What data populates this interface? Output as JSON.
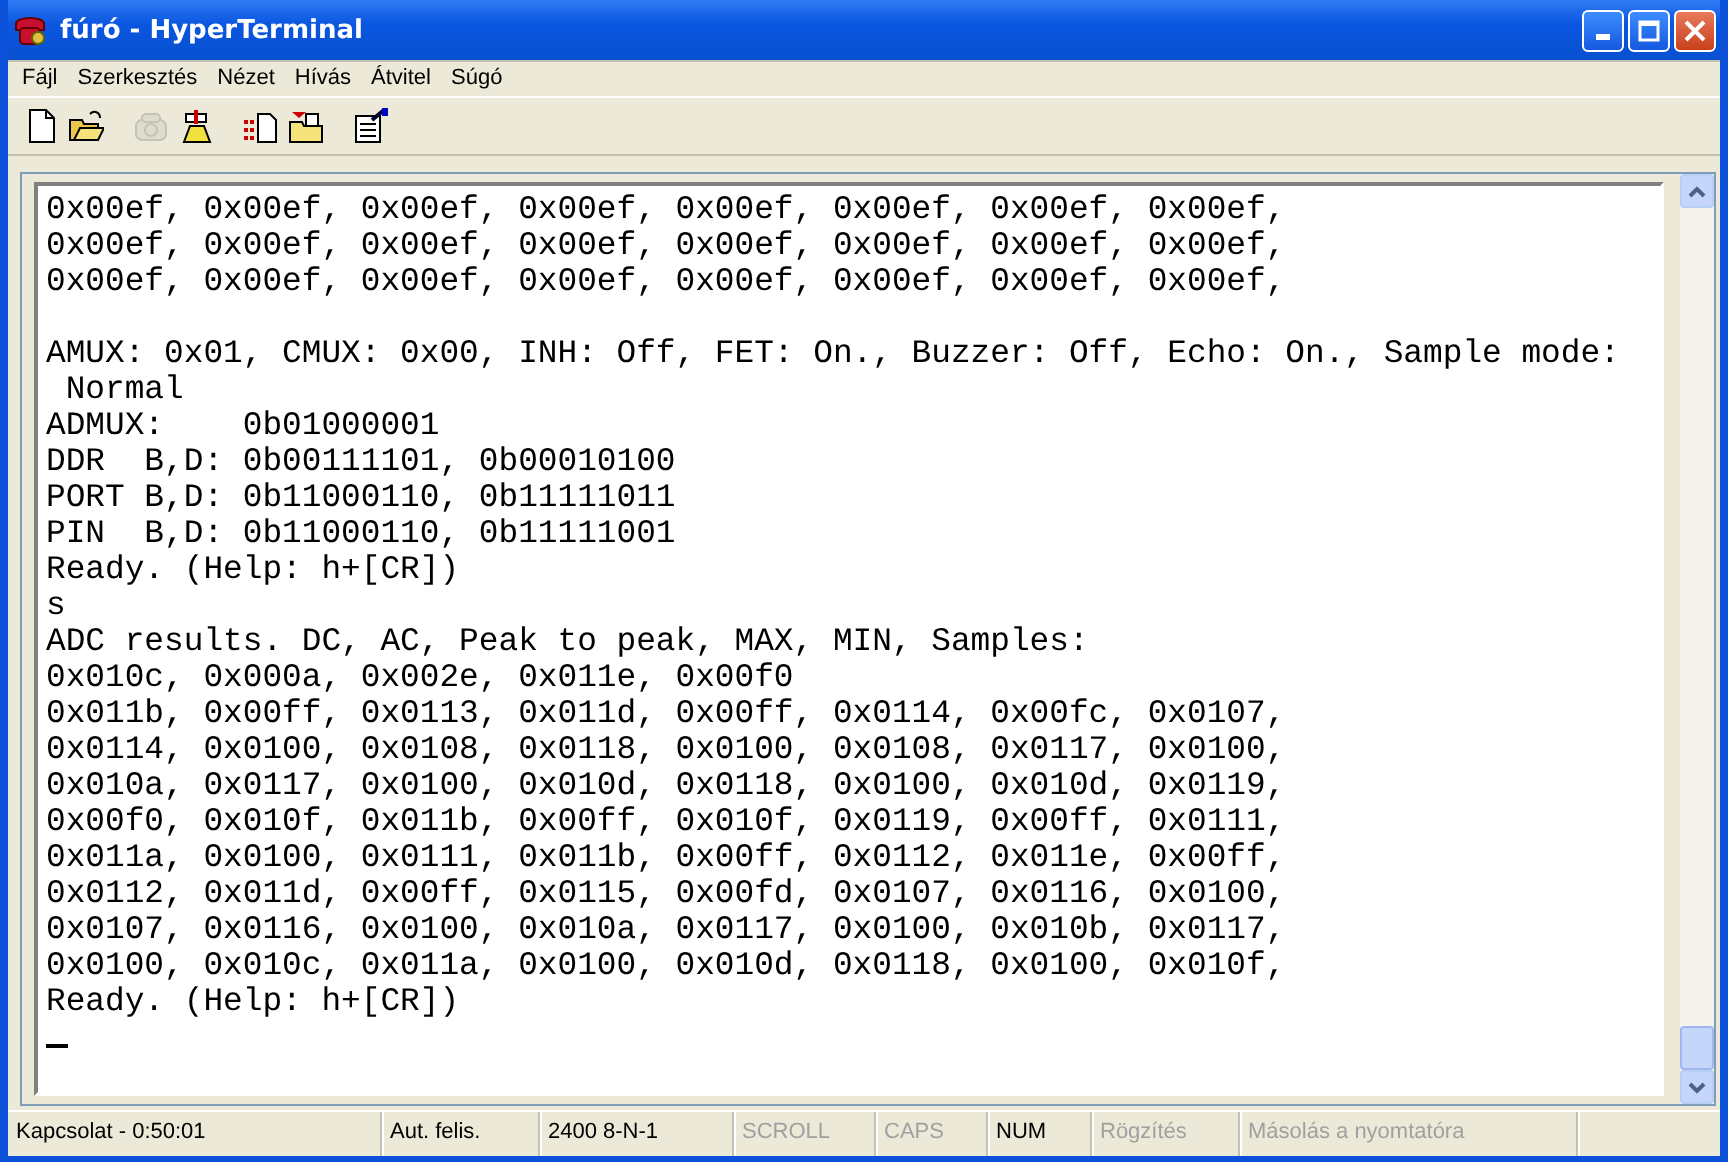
{
  "window": {
    "title": "fúró - HyperTerminal"
  },
  "menu": [
    {
      "label": "Fájl"
    },
    {
      "label": "Szerkesztés"
    },
    {
      "label": "Nézet"
    },
    {
      "label": "Hívás"
    },
    {
      "label": "Átvitel"
    },
    {
      "label": "Súgó"
    }
  ],
  "toolbar": [
    {
      "kind": "new",
      "disabled": false
    },
    {
      "kind": "open",
      "disabled": false
    },
    {
      "kind": "separator"
    },
    {
      "kind": "call",
      "disabled": true
    },
    {
      "kind": "hangup",
      "disabled": false
    },
    {
      "kind": "separator"
    },
    {
      "kind": "send",
      "disabled": false
    },
    {
      "kind": "receive",
      "disabled": false
    },
    {
      "kind": "separator"
    },
    {
      "kind": "properties",
      "disabled": false
    }
  ],
  "terminal": {
    "blocks": [
      [
        "0x00ef, 0x00ef, 0x00ef, 0x00ef, 0x00ef, 0x00ef, 0x00ef, 0x00ef,",
        "0x00ef, 0x00ef, 0x00ef, 0x00ef, 0x00ef, 0x00ef, 0x00ef, 0x00ef,",
        "0x00ef, 0x00ef, 0x00ef, 0x00ef, 0x00ef, 0x00ef, 0x00ef, 0x00ef,"
      ],
      [
        "AMUX: 0x01, CMUX: 0x00, INH: Off, FET: On., Buzzer: Off, Echo: On., Sample mode:",
        " Normal",
        "ADMUX:    0b01000001",
        "DDR  B,D: 0b00111101, 0b00010100",
        "PORT B,D: 0b11000110, 0b11111011",
        "PIN  B,D: 0b11000110, 0b11111001",
        "Ready. (Help: h+[CR])",
        "s",
        "ADC results. DC, AC, Peak to peak, MAX, MIN, Samples:",
        "0x010c, 0x000a, 0x002e, 0x011e, 0x00f0",
        "0x011b, 0x00ff, 0x0113, 0x011d, 0x00ff, 0x0114, 0x00fc, 0x0107,",
        "0x0114, 0x0100, 0x0108, 0x0118, 0x0100, 0x0108, 0x0117, 0x0100,",
        "0x010a, 0x0117, 0x0100, 0x010d, 0x0118, 0x0100, 0x010d, 0x0119,",
        "0x00f0, 0x010f, 0x011b, 0x00ff, 0x010f, 0x0119, 0x00ff, 0x0111,",
        "0x011a, 0x0100, 0x0111, 0x011b, 0x00ff, 0x0112, 0x011e, 0x00ff,",
        "0x0112, 0x011d, 0x00ff, 0x0115, 0x00fd, 0x0107, 0x0116, 0x0100,",
        "0x0107, 0x0116, 0x0100, 0x010a, 0x0117, 0x0100, 0x010b, 0x0117,",
        "0x0100, 0x010c, 0x011a, 0x0100, 0x010d, 0x0118, 0x0100, 0x010f,",
        "Ready. (Help: h+[CR])"
      ]
    ]
  },
  "status_bar": [
    {
      "text": "Kapcsolat - 0:50:01",
      "disabled": false
    },
    {
      "text": "Aut. felis.",
      "disabled": false
    },
    {
      "text": "2400 8-N-1",
      "disabled": false
    },
    {
      "text": "SCROLL",
      "disabled": true
    },
    {
      "text": "CAPS",
      "disabled": true
    },
    {
      "text": "NUM",
      "disabled": false
    },
    {
      "text": "Rögzítés",
      "disabled": true
    },
    {
      "text": "Másolás a nyomtatóra",
      "disabled": true
    }
  ]
}
